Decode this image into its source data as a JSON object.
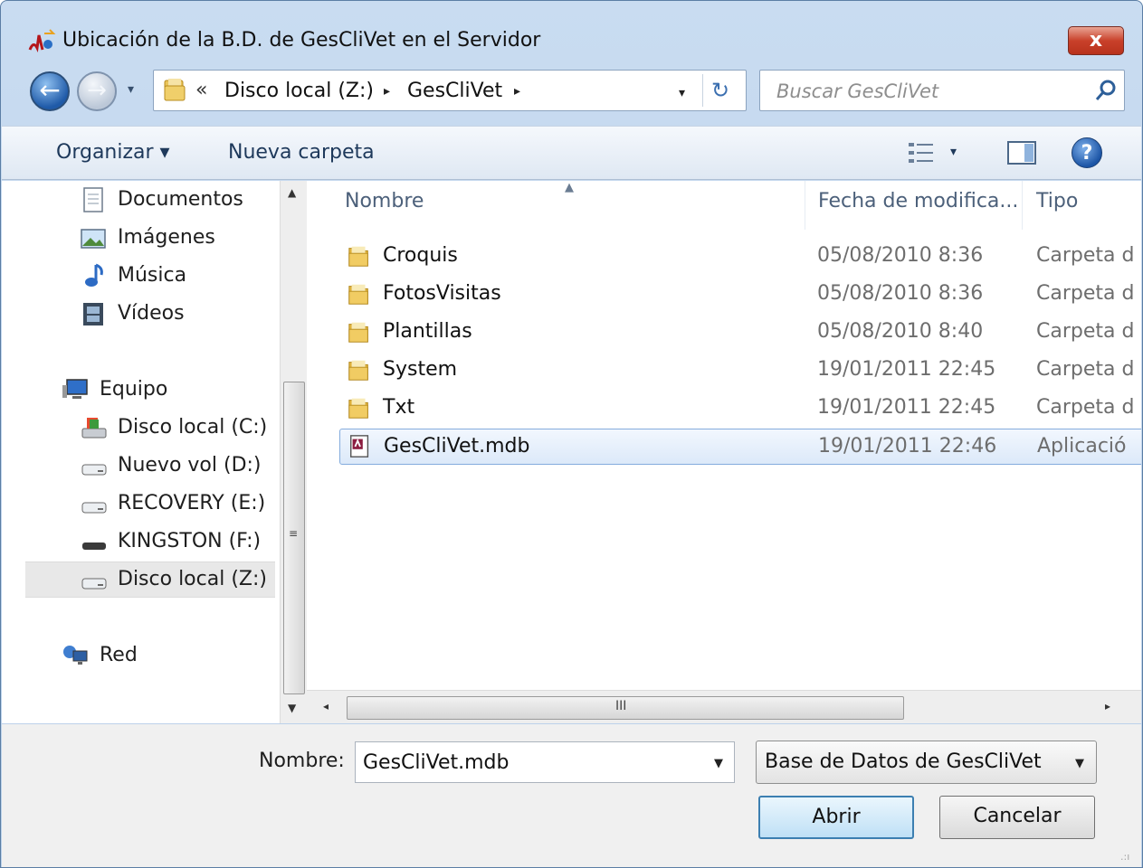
{
  "window": {
    "title": "Ubicación de la B.D. de GesCliVet en el Servidor",
    "close_label": "x"
  },
  "address": {
    "overflow_chevron": "«",
    "crumbs": [
      "Disco local (Z:)",
      "GesCliVet"
    ],
    "crumb_arrow": "▸",
    "dropdown_arrow": "▾",
    "refresh_symbol": "↻"
  },
  "search": {
    "placeholder": "Buscar GesCliVet"
  },
  "toolbar": {
    "organize_label": "Organizar ▾",
    "new_folder_label": "Nueva carpeta",
    "views_dropdown": "▾",
    "help_label": "?"
  },
  "nav_pane": {
    "items": [
      {
        "label": "Documentos",
        "icon": "documents-icon"
      },
      {
        "label": "Imágenes",
        "icon": "pictures-icon"
      },
      {
        "label": "Música",
        "icon": "music-icon"
      },
      {
        "label": "Vídeos",
        "icon": "videos-icon"
      },
      {
        "label": "Equipo",
        "icon": "computer-icon"
      },
      {
        "label": "Disco local (C:)",
        "icon": "system-drive-icon"
      },
      {
        "label": "Nuevo vol (D:)",
        "icon": "drive-icon"
      },
      {
        "label": "RECOVERY (E:)",
        "icon": "drive-icon"
      },
      {
        "label": "KINGSTON (F:)",
        "icon": "usb-drive-icon"
      },
      {
        "label": "Disco local (Z:)",
        "icon": "drive-icon",
        "selected": true
      },
      {
        "label": "Red",
        "icon": "network-icon"
      }
    ]
  },
  "file_list": {
    "columns": [
      "Nombre",
      "Fecha de modifica...",
      "Tipo"
    ],
    "rows": [
      {
        "name": "Croquis",
        "date": "05/08/2010 8:36",
        "type": "Carpeta d",
        "icon": "folder-icon"
      },
      {
        "name": "FotosVisitas",
        "date": "05/08/2010 8:36",
        "type": "Carpeta d",
        "icon": "folder-icon"
      },
      {
        "name": "Plantillas",
        "date": "05/08/2010 8:40",
        "type": "Carpeta d",
        "icon": "folder-icon"
      },
      {
        "name": "System",
        "date": "19/01/2011 22:45",
        "type": "Carpeta d",
        "icon": "folder-icon"
      },
      {
        "name": "Txt",
        "date": "19/01/2011 22:45",
        "type": "Carpeta d",
        "icon": "folder-icon"
      },
      {
        "name": "GesCliVet.mdb",
        "date": "19/01/2011 22:46",
        "type": "Aplicació",
        "icon": "access-db-icon",
        "selected": true
      }
    ]
  },
  "scrollbars": {
    "up": "▲",
    "down": "▼",
    "left": "◂",
    "right": "▸",
    "grip_v": "≡",
    "grip_h": "III"
  },
  "footer": {
    "filename_label": "Nombre:",
    "filename_value": "GesCliVet.mdb",
    "filetype_value": "Base de Datos de GesCliVet",
    "dropdown_arrow": "▼",
    "open_label": "Abrir",
    "cancel_label": "Cancelar",
    "resize_grip": ".:ı"
  },
  "colors": {
    "chrome": "#c9dcf1",
    "selection": "#dce9f9",
    "close_red": "#c9412a"
  }
}
